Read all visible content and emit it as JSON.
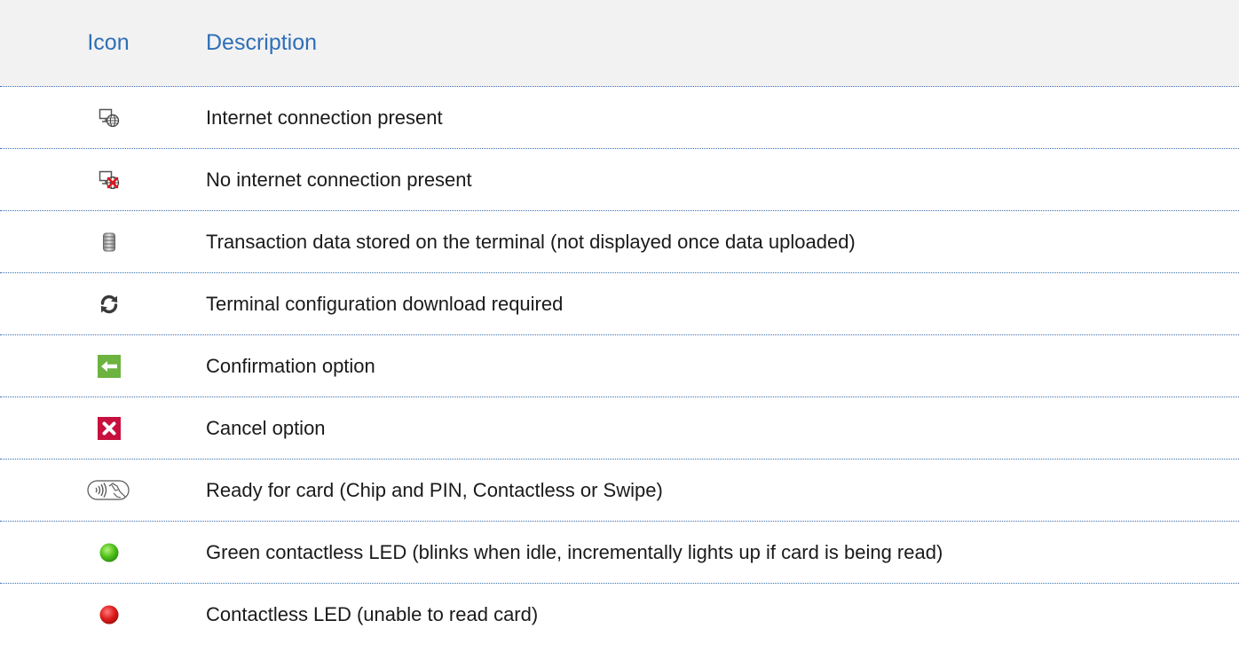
{
  "header": {
    "icon_label": "Icon",
    "description_label": "Description"
  },
  "colors": {
    "header_text": "#2e6fb7",
    "header_bg": "#f2f2f2",
    "divider": "#3a6fb0",
    "confirm_green": "#6cb33f",
    "cancel_red": "#c8103e",
    "led_green": "#4fc21b",
    "led_red": "#e01e1e"
  },
  "rows": [
    {
      "icon": "internet-connected-icon",
      "description": "Internet connection present"
    },
    {
      "icon": "no-internet-icon",
      "description": "No internet connection present"
    },
    {
      "icon": "stored-data-icon",
      "description": "Transaction data stored on the terminal (not displayed once data uploaded)"
    },
    {
      "icon": "refresh-icon",
      "description": "Terminal configuration download required"
    },
    {
      "icon": "confirm-arrow-icon",
      "description": "Confirmation option"
    },
    {
      "icon": "cancel-x-icon",
      "description": "Cancel option"
    },
    {
      "icon": "contactless-card-icon",
      "description": "Ready for card (Chip and PIN, Contactless or Swipe)"
    },
    {
      "icon": "green-led-icon",
      "description": "Green contactless LED (blinks when idle, incrementally lights up if card is being read)"
    },
    {
      "icon": "red-led-icon",
      "description": "Contactless LED (unable to read card)"
    }
  ]
}
